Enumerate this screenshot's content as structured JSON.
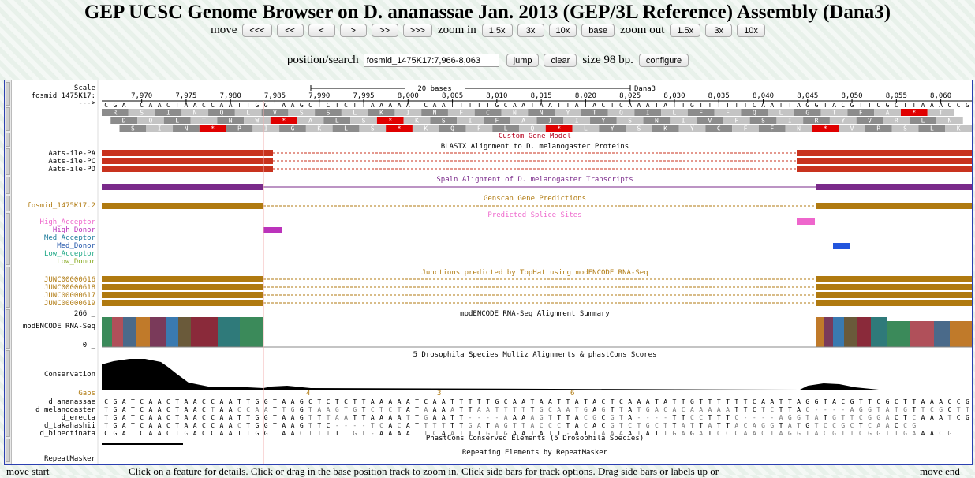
{
  "title": "GEP UCSC Genome Browser on D. ananassae Jan. 2013 (GEP/3L Reference) Assembly (Dana3)",
  "nav": {
    "move_label": "move",
    "move_buttons": [
      "<<<",
      "<<",
      "<",
      ">",
      ">>",
      ">>>"
    ],
    "zoom_in_label": "zoom in",
    "zoom_in_buttons": [
      "1.5x",
      "3x",
      "10x",
      "base"
    ],
    "zoom_out_label": "zoom out",
    "zoom_out_buttons": [
      "1.5x",
      "3x",
      "10x"
    ]
  },
  "search": {
    "label": "position/search",
    "value": "fosmid_1475K17:7,966-8,063",
    "jump": "jump",
    "clear": "clear",
    "size_text": "size 98 bp.",
    "configure": "configure"
  },
  "ruler": {
    "scale_label": "Scale",
    "chrom_label": "fosmid_1475K17:",
    "strand_label": "--->",
    "bar_text": "20 bases",
    "assembly": "Dana3",
    "ticks": [
      "7,970",
      "7,975",
      "7,980",
      "7,985",
      "7,990",
      "7,995",
      "8,000",
      "8,005",
      "8,010",
      "8,015",
      "8,020",
      "8,025",
      "8,030",
      "8,035",
      "8,040",
      "8,045",
      "8,050",
      "8,055",
      "8,060"
    ]
  },
  "dna": "CGATCAACTAACCAATTGGTAAGCTCTCTTAAAAATCAATTTTTGCAATAATTATACTCAAATATTGTTTTTTCAATTAGGTACGTTCGCTTAAACCG",
  "frames": [
    "R S I N Q L V S S L K I N F C N N Y T Q I L F F Q L G T F A * T",
    "D Q L T N W * A L S * K S I F A I I Y S N I V F S I R Y V R L N",
    "S I N * P I G K L S * K Q F L Q * L Y S K Y C F F N * V R S L K P"
  ],
  "tracks": {
    "custom_gene_model": "Custom Gene Model",
    "blastx_title": "BLASTX Alignment to D. melanogaster Proteins",
    "blastx_items": [
      "Aats-ile-PA",
      "Aats-ile-PC",
      "Aats-ile-PD"
    ],
    "spaln_title": "Spaln Alignment of D. melanogaster Transcripts",
    "genscan_title": "Genscan Gene Predictions",
    "genscan_item": "fosmid_1475K17.2",
    "splice_title": "Predicted Splice Sites",
    "splice_items": [
      "High_Acceptor",
      "High_Donor",
      "Med_Acceptor",
      "Med_Donor",
      "Low_Acceptor",
      "Low_Donor"
    ],
    "tophat_title": "Junctions predicted by TopHat using modENCODE RNA-Seq",
    "tophat_items": [
      "JUNC00000616",
      "JUNC00000618",
      "JUNC00000617",
      "JUNC00000619"
    ],
    "rnaseq_title": "modENCODE RNA-Seq Alignment Summary",
    "rnaseq_label": "modENCODE RNA-Seq",
    "rnaseq_max": "266 _",
    "rnaseq_min": "0 _",
    "multiz_title": "5 Drosophila Species Multiz Alignments & phastCons Scores",
    "conservation_label": "Conservation",
    "gaps_label": "Gaps",
    "gap_marks": [
      "4",
      "3",
      "6"
    ],
    "species": [
      "d_ananassae",
      "d_melanogaster",
      "d_erecta",
      "d_takahashii",
      "d_bipectinata"
    ],
    "species_seqs": [
      "CGATCAACTAACCAATTGGTAAGCTCTCTTAAAAATCAATTTTTGCAATAATTATACTCAAATATTGTTTTTTCAATTAGGTACGTTCGCTTAAACCG",
      "TGATCAACTAACTAACCAATTGGTAAGTGTCTCTATAAAATTAATTTTTGCAATGAGTTATGACACAAAAATTCTCTTAC----AGGTATGTTCGCTTAAATCG",
      "TGATCAACTAACCAATTGGTAAGTTTAATTAAAATTGAATT----AAAAGTTTACGCGTA----TTCCTTTC----AGGTATGTTCGGACTCAAATCG",
      "TGATCAACTAACCAACTGGTAAGTTC----TCACATTTTTTGATAGTTACCCTACACGTCTGCTTATTATTACAGGTATGTCCGCTCAACCG",
      "CGATCAACTGACCAATTGGTAACTTTTTGT-AAAATTCAATTTGTGAATATT-ATTAAAATATTGAGATCCCAACTAGGTACGTTCGGTTGAAACG"
    ],
    "phastcons_title": "PhastCons Conserved Elements (5 Drosophila Species)",
    "repeat_title": "Repeating Elements by RepeatMasker",
    "repeat_label": "RepeatMasker"
  },
  "footer": {
    "move_start": "move start",
    "hint": "Click on a feature for details. Click or drag in the base position track to zoom in. Click side bars for track options. Drag side bars or labels up or",
    "move_end": "move end"
  },
  "colors": {
    "blastx": "#c8321e",
    "spaln": "#7a2a8a",
    "genscan": "#b07a10",
    "splice_high_acceptor": "#ee66cc",
    "splice_high_donor": "#bb33bb",
    "splice_med_donor": "#2255dd",
    "track_title": "#b4001e"
  }
}
